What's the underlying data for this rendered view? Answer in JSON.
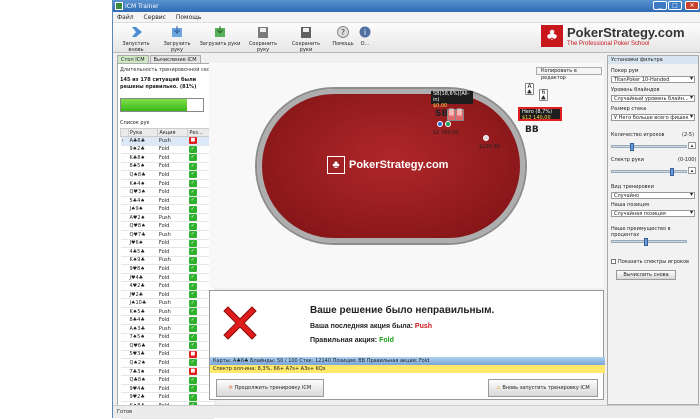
{
  "window": {
    "title": "ICM Trainer"
  },
  "menu": [
    "Файл",
    "Сервис",
    "Помощь"
  ],
  "toolbar": [
    {
      "label": "Запустить вновь",
      "icon": "restart-icon"
    },
    {
      "label": "Загрузить руку",
      "icon": "load-hand-icon"
    },
    {
      "label": "Загрузить руки",
      "icon": "load-hands-icon"
    },
    {
      "label": "Сохранить руку",
      "icon": "save-hand-icon"
    },
    {
      "label": "Сохранить руки",
      "icon": "save-hands-icon"
    },
    {
      "label": "Помощь",
      "icon": "help-icon"
    },
    {
      "label": "О...",
      "icon": "info-icon"
    }
  ],
  "brand": {
    "name": "PokerStrategy.com",
    "tagline": "The Professional Poker School"
  },
  "tabs": [
    "Стол ICM",
    "Вычисление ICM"
  ],
  "left": {
    "duration_label": "Длительность тренировочной сесси",
    "duration_value": "145 из 178 ситуаций были решены правильно. (81%)",
    "progress": 0.81,
    "list_label": "Список рук",
    "headers": [
      "Рука",
      "Акция",
      "Рез..."
    ],
    "rows": [
      {
        "hand": "A♣6♣",
        "action": "Push",
        "ok": false
      },
      {
        "hand": "9♠2♣",
        "action": "Fold",
        "ok": true
      },
      {
        "hand": "K♣8♠",
        "action": "Fold",
        "ok": true
      },
      {
        "hand": "8♣5♠",
        "action": "Fold",
        "ok": true
      },
      {
        "hand": "Q♠8♣",
        "action": "Fold",
        "ok": true
      },
      {
        "hand": "K♠4♠",
        "action": "Fold",
        "ok": true
      },
      {
        "hand": "Q♥3♠",
        "action": "Fold",
        "ok": true
      },
      {
        "hand": "5♣4♠",
        "action": "Fold",
        "ok": true
      },
      {
        "hand": "J♠9♠",
        "action": "Fold",
        "ok": true
      },
      {
        "hand": "A♥2♠",
        "action": "Push",
        "ok": true
      },
      {
        "hand": "Q♥8♠",
        "action": "Fold",
        "ok": true
      },
      {
        "hand": "Q♥7♣",
        "action": "Push",
        "ok": true
      },
      {
        "hand": "J♥6♠",
        "action": "Fold",
        "ok": true
      },
      {
        "hand": "4♣5♣",
        "action": "Fold",
        "ok": true
      },
      {
        "hand": "K♠9♣",
        "action": "Push",
        "ok": true
      },
      {
        "hand": "9♥8♠",
        "action": "Fold",
        "ok": true
      },
      {
        "hand": "J♥4♣",
        "action": "Fold",
        "ok": true
      },
      {
        "hand": "4♥2♣",
        "action": "Fold",
        "ok": true
      },
      {
        "hand": "J♥2♣",
        "action": "Fold",
        "ok": true
      },
      {
        "hand": "J♠10♣",
        "action": "Push",
        "ok": true
      },
      {
        "hand": "K♠5♣",
        "action": "Push",
        "ok": true
      },
      {
        "hand": "8♣4♣",
        "action": "Fold",
        "ok": true
      },
      {
        "hand": "A♠3♣",
        "action": "Push",
        "ok": true
      },
      {
        "hand": "7♠5♠",
        "action": "Fold",
        "ok": true
      },
      {
        "hand": "Q♥6♣",
        "action": "Fold",
        "ok": true
      },
      {
        "hand": "5♥3♣",
        "action": "Fold",
        "ok": false
      },
      {
        "hand": "Q♠2♠",
        "action": "Fold",
        "ok": true
      },
      {
        "hand": "7♣3♠",
        "action": "Fold",
        "ok": false
      },
      {
        "hand": "Q♣8♠",
        "action": "Fold",
        "ok": true
      },
      {
        "hand": "9♥4♣",
        "action": "Fold",
        "ok": true
      },
      {
        "hand": "9♥2♣",
        "action": "Fold",
        "ok": true
      },
      {
        "hand": "K♠8♣",
        "action": "Fold",
        "ok": true
      },
      {
        "hand": "8♠2♣",
        "action": "Fold",
        "ok": true
      }
    ]
  },
  "table": {
    "copy_btn": "Копировать в редактор",
    "felt_logo": "PokerStrategy.com",
    "sb": {
      "name": "SB(18,6%)(All-in)",
      "stack": "$0,00",
      "pos": "SB",
      "bet": "$2 760,00"
    },
    "bb": {
      "bet": "$100,00"
    },
    "hero": {
      "name": "Hero (8,7%)",
      "stack": "$12 140,00",
      "pos": "BB"
    }
  },
  "result": {
    "title": "Ваше решение было неправильным.",
    "last_label": "Ваша последняя акция была:",
    "last_value": "Push",
    "correct_label": "Правильная акция:",
    "correct_value": "Fold",
    "info": "Карты:     A♣6♣     Блайнды:    50 / 100     Стек:    12140     Позиция:    BB     Правильная акция:          Fold",
    "range": "Спектр олл-ина:      8,3%, 66+ A7s+ A3s+ KQs",
    "btn_continue": "Продолжить тренировку ICM",
    "btn_restart": "Вновь запустить тренировку ICM"
  },
  "filters": {
    "header": "Установки фильтра",
    "poker_room_label": "Покер рум",
    "poker_room": "TitanPoker 10-Handed",
    "blind_level_label": "Уровень блайндов",
    "blind_level": "Случайный уровень блайн...",
    "stack_size_label": "Размер стека",
    "stack_size": "У Него больше всего фишек",
    "players_label": "Количество игроков",
    "players_range": "(2-5)",
    "players_slider": 0.25,
    "range_label": "Спектр руки",
    "range_range": "(0-100)",
    "range_slider": 0.8,
    "training_label": "Вид тренировки",
    "training": "Случайно",
    "position_label": "Наша позиция",
    "position": "Случайная позиция",
    "advantage_label": "Наше преимущество в процентах",
    "advantage_slider": 0.45,
    "show_ranges": "Показать спектры игроков",
    "calc_btn": "Вычислить снова",
    "colors": {
      "accent": "#c7161c",
      "felt": "#9b1b1e",
      "ok": "#2fb02f",
      "bad": "#e01b1b"
    }
  },
  "status": "Готов"
}
